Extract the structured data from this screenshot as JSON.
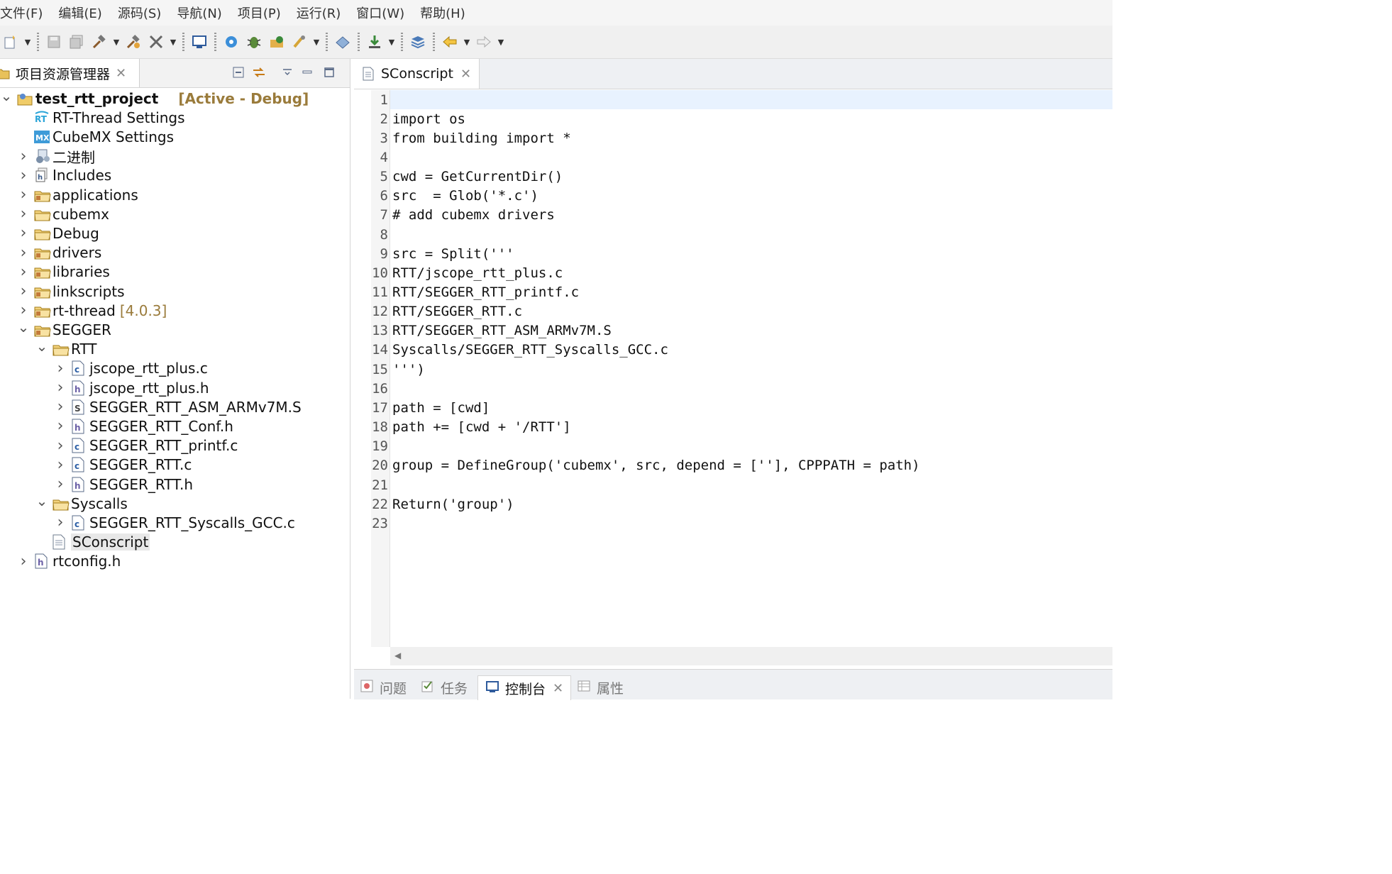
{
  "menu": [
    "文件(F)",
    "编辑(E)",
    "源码(S)",
    "导航(N)",
    "项目(P)",
    "运行(R)",
    "窗口(W)",
    "帮助(H)"
  ],
  "toolbar": {
    "icons": [
      "new-icon",
      "save-icon",
      "save-all-icon",
      "build-icon",
      "build-config-icon",
      "tools-icon",
      "terminal-icon",
      "settings-gear-icon",
      "debug-bug-icon",
      "run-icon",
      "external-tools-icon",
      "open-type-icon",
      "download-icon",
      "layers-icon",
      "back-arrow-icon",
      "forward-arrow-icon"
    ]
  },
  "explorer": {
    "title": "项目资源管理器",
    "tree": [
      {
        "label": "test_rtt_project",
        "deco": "[Active - Debug]",
        "level": 0,
        "toggle": "expanded",
        "icon": "project",
        "bold": true
      },
      {
        "label": "RT-Thread Settings",
        "level": 1,
        "toggle": "none",
        "icon": "rt"
      },
      {
        "label": "CubeMX Settings",
        "level": 1,
        "toggle": "none",
        "icon": "mx"
      },
      {
        "label": "二进制",
        "level": 1,
        "toggle": "collapsed",
        "icon": "binaries"
      },
      {
        "label": "Includes",
        "level": 1,
        "toggle": "collapsed",
        "icon": "includes"
      },
      {
        "label": "applications",
        "level": 1,
        "toggle": "collapsed",
        "icon": "src-folder"
      },
      {
        "label": "cubemx",
        "level": 1,
        "toggle": "collapsed",
        "icon": "folder"
      },
      {
        "label": "Debug",
        "level": 1,
        "toggle": "collapsed",
        "icon": "folder"
      },
      {
        "label": "drivers",
        "level": 1,
        "toggle": "collapsed",
        "icon": "src-folder"
      },
      {
        "label": "libraries",
        "level": 1,
        "toggle": "collapsed",
        "icon": "src-folder"
      },
      {
        "label": "linkscripts",
        "level": 1,
        "toggle": "collapsed",
        "icon": "src-folder"
      },
      {
        "label": "rt-thread",
        "deco": "[4.0.3]",
        "level": 1,
        "toggle": "collapsed",
        "icon": "src-folder"
      },
      {
        "label": "SEGGER",
        "level": 1,
        "toggle": "expanded",
        "icon": "src-folder"
      },
      {
        "label": "RTT",
        "level": 2,
        "toggle": "expanded",
        "icon": "folder"
      },
      {
        "label": "jscope_rtt_plus.c",
        "level": 3,
        "toggle": "collapsed",
        "icon": "c"
      },
      {
        "label": "jscope_rtt_plus.h",
        "level": 3,
        "toggle": "collapsed",
        "icon": "h"
      },
      {
        "label": "SEGGER_RTT_ASM_ARMv7M.S",
        "level": 3,
        "toggle": "collapsed",
        "icon": "s"
      },
      {
        "label": "SEGGER_RTT_Conf.h",
        "level": 3,
        "toggle": "collapsed",
        "icon": "h"
      },
      {
        "label": "SEGGER_RTT_printf.c",
        "level": 3,
        "toggle": "collapsed",
        "icon": "c"
      },
      {
        "label": "SEGGER_RTT.c",
        "level": 3,
        "toggle": "collapsed",
        "icon": "c"
      },
      {
        "label": "SEGGER_RTT.h",
        "level": 3,
        "toggle": "collapsed",
        "icon": "h"
      },
      {
        "label": "Syscalls",
        "level": 2,
        "toggle": "expanded",
        "icon": "folder"
      },
      {
        "label": "SEGGER_RTT_Syscalls_GCC.c",
        "level": 3,
        "toggle": "collapsed",
        "icon": "c"
      },
      {
        "label": "SConscript",
        "level": 2,
        "toggle": "none",
        "icon": "text",
        "selected": true
      },
      {
        "label": "rtconfig.h",
        "level": 1,
        "toggle": "collapsed",
        "icon": "h"
      }
    ]
  },
  "editor": {
    "tab": "SConscript",
    "lines": [
      "",
      "import os",
      "from building import *",
      "",
      "cwd = GetCurrentDir()",
      "src  = Glob('*.c')",
      "# add cubemx drivers",
      "",
      "src = Split('''",
      "RTT/jscope_rtt_plus.c",
      "RTT/SEGGER_RTT_printf.c",
      "RTT/SEGGER_RTT.c",
      "RTT/SEGGER_RTT_ASM_ARMv7M.S",
      "Syscalls/SEGGER_RTT_Syscalls_GCC.c",
      "''')",
      "",
      "path = [cwd]",
      "path += [cwd + '/RTT']",
      "",
      "group = DefineGroup('cubemx', src, depend = [''], CPPPATH = path)",
      "",
      "Return('group')",
      ""
    ]
  },
  "bottom_tabs": [
    {
      "label": "问题",
      "icon": "problems-icon",
      "active": false
    },
    {
      "label": "任务",
      "icon": "tasks-icon",
      "active": false
    },
    {
      "label": "控制台",
      "icon": "console-icon",
      "active": true
    },
    {
      "label": "属性",
      "icon": "properties-icon",
      "active": false
    }
  ],
  "colors": {
    "deco": "#9a7b3b",
    "selection": "#e8e8e8",
    "current_line": "#e8f2fe",
    "accent_blue": "#1c6cc4"
  }
}
